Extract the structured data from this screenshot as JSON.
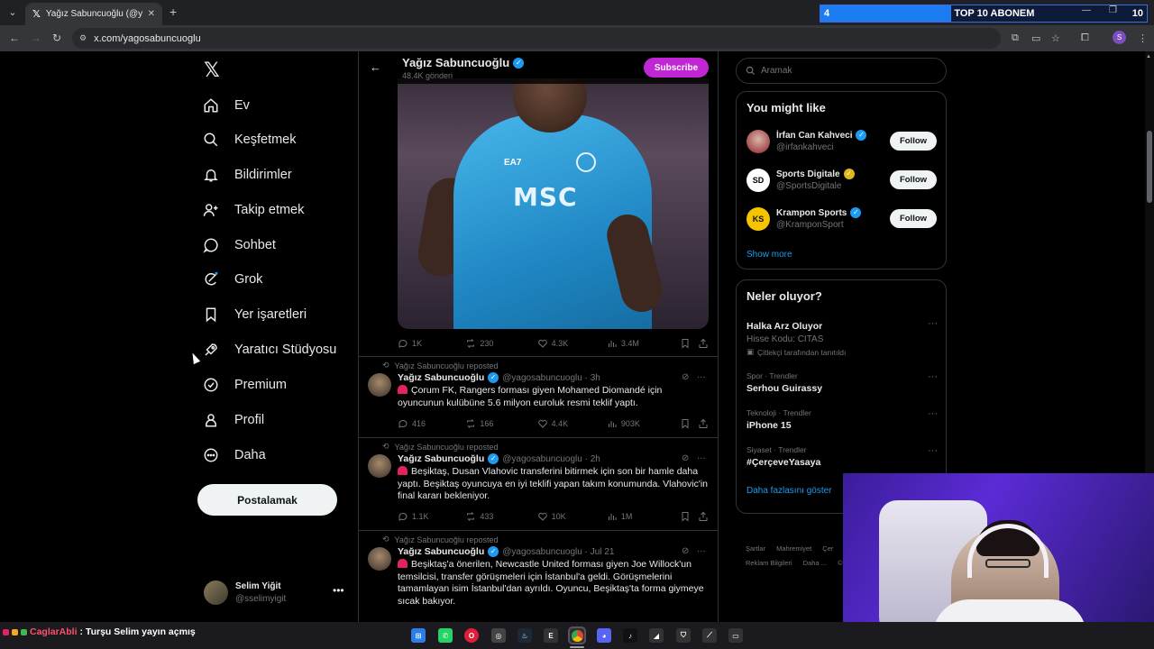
{
  "browser": {
    "tab_title": "Yağız Sabuncuoğlu (@yagosab",
    "url": "x.com/yagosabuncuoglu",
    "profile_initial": "S"
  },
  "banner": {
    "left": "4",
    "center": "TOP 10 ABONEM",
    "right": "10",
    "progress": 0.4
  },
  "sidebar": {
    "items": [
      {
        "label": "Ev",
        "icon": "home-icon"
      },
      {
        "label": "Keşfetmek",
        "icon": "search-icon"
      },
      {
        "label": "Bildirimler",
        "icon": "bell-icon"
      },
      {
        "label": "Takip etmek",
        "icon": "person-add-icon"
      },
      {
        "label": "Sohbet",
        "icon": "chat-icon"
      },
      {
        "label": "Grok",
        "icon": "grok-icon"
      },
      {
        "label": "Yer işaretleri",
        "icon": "bookmark-icon"
      },
      {
        "label": "Yaratıcı Stüdyosu",
        "icon": "rocket-icon"
      },
      {
        "label": "Premium",
        "icon": "premium-icon"
      },
      {
        "label": "Profil",
        "icon": "profile-icon"
      },
      {
        "label": "Daha",
        "icon": "more-circle-icon"
      }
    ],
    "post_button": "Postalamak",
    "user": {
      "name": "Selim Yiğit",
      "handle": "@sselimyigit"
    }
  },
  "profile_header": {
    "name": "Yağız Sabuncuoğlu",
    "posts": "48.4K gönderi",
    "subscribe": "Subscribe"
  },
  "photo": {
    "ea7": "EA7",
    "sponsor": "MSC"
  },
  "first_actions": {
    "replies": "1K",
    "reposts": "230",
    "likes": "4.3K",
    "views": "3.4M"
  },
  "posts": [
    {
      "repost_label": "Yağız Sabuncuoğlu reposted",
      "name": "Yağız Sabuncuoğlu",
      "meta": "@yagosabuncuoglu · 3h",
      "text": "Çorum FK, Rangers forması giyen Mohamed Diomandé için oyuncunun kulübüne 5.6 milyon euroluk resmi teklif yaptı.",
      "replies": "416",
      "reposts": "166",
      "likes": "4.4K",
      "views": "903K"
    },
    {
      "repost_label": "Yağız Sabuncuoğlu reposted",
      "name": "Yağız Sabuncuoğlu",
      "meta": "@yagosabuncuoglu · 2h",
      "text": "Beşiktaş, Dusan Vlahovic transferini bitirmek için son bir hamle daha yaptı. Beşiktaş oyuncuya en iyi teklifi yapan takım konumunda. Vlahovic'in final kararı bekleniyor.",
      "replies": "1.1K",
      "reposts": "433",
      "likes": "10K",
      "views": "1M"
    },
    {
      "repost_label": "Yağız Sabuncuoğlu reposted",
      "name": "Yağız Sabuncuoğlu",
      "meta": "@yagosabuncuoglu · Jul 21",
      "text": "Beşiktaş'a önerilen, Newcastle United forması giyen Joe Willock'un temsilcisi, transfer görüşmeleri için İstanbul'a geldi. Görüşmelerini tamamlayan isim İstanbul'dan ayrıldı. Oyuncu, Beşiktaş'ta forma giymeye sıcak bakıyor."
    }
  ],
  "right": {
    "search_placeholder": "Aramak",
    "you_might_like": {
      "title": "You might like",
      "items": [
        {
          "name": "İrfan Can Kahveci",
          "handle": "@irfankahveci",
          "follow": "Follow",
          "badge": "#1d9bf0"
        },
        {
          "name": "Sports Digitale",
          "handle": "@SportsDigitale",
          "follow": "Follow",
          "badge": "#e2b719",
          "avatar": "SD"
        },
        {
          "name": "Krampon Sports",
          "handle": "@KramponSport",
          "follow": "Follow",
          "badge": "#1d9bf0",
          "avatar": "KS"
        }
      ],
      "show_more": "Show more"
    },
    "trends": {
      "title": "Neler oluyor?",
      "items": [
        {
          "title": "Halka Arz Oluyor",
          "sub": "Hisse Kodu: CITAS",
          "promo": "Çitlekçi tarafından tanıtıldı"
        },
        {
          "category": "Spor · Trendler",
          "title": "Serhou Guirassy"
        },
        {
          "category": "Teknoloji · Trendler",
          "title": "iPhone 15"
        },
        {
          "category": "Siyaset · Trendler",
          "title": "#ÇerçeveYasaya"
        }
      ],
      "show_more": "Daha fazlasını göster"
    },
    "footer": {
      "row1": [
        "Şartlar",
        "Mahremiyet",
        "Çer"
      ],
      "row2": [
        "Reklam Bilgileri",
        "Daha ...",
        "©"
      ]
    }
  },
  "taskbar": {
    "chat_user": "CaglarAbli",
    "chat_msg": ": Turşu Selim yayın açmış"
  }
}
